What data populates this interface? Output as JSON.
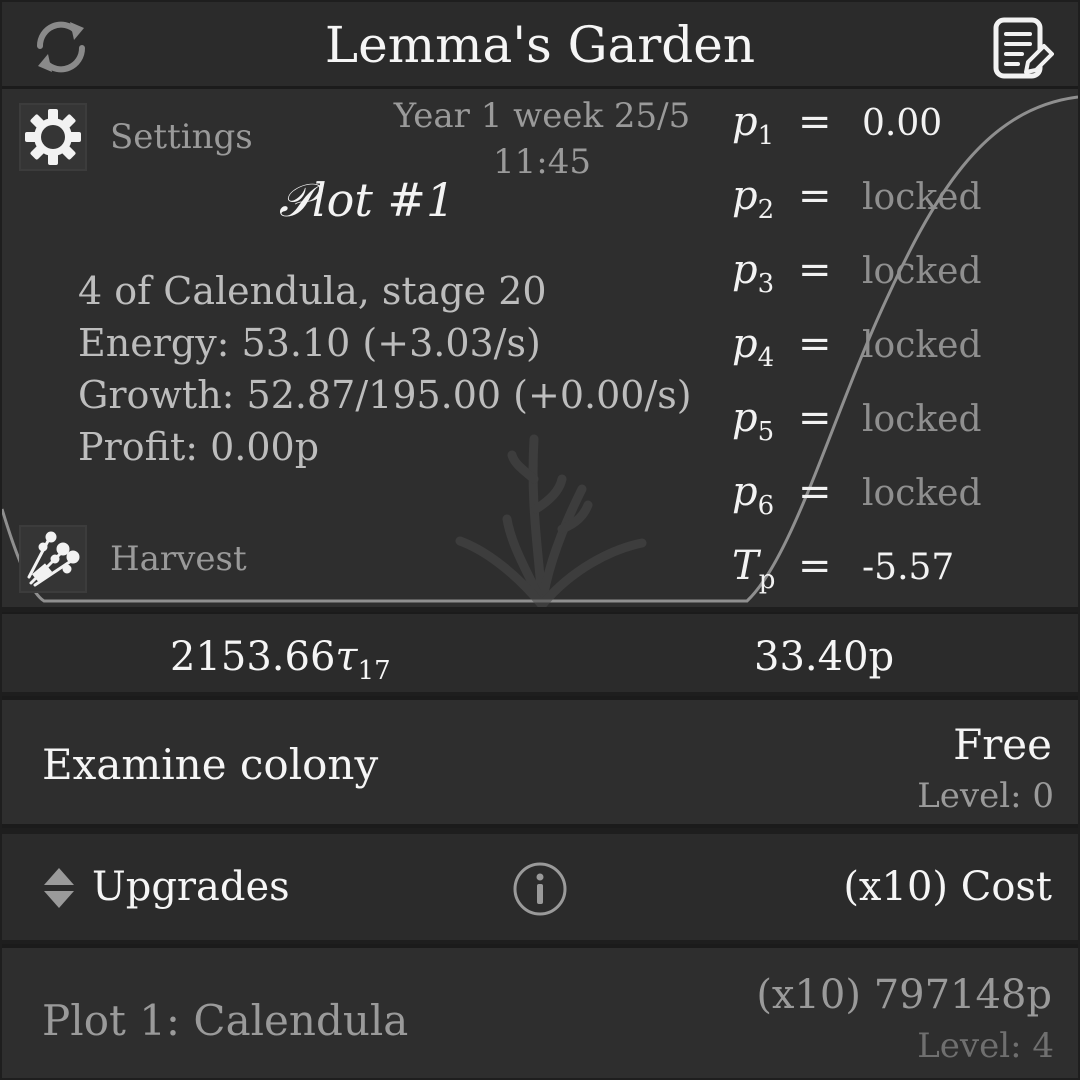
{
  "header": {
    "title": "Lemma's Garden",
    "left_icon": "refresh-icon",
    "right_icon": "notes-edit-icon"
  },
  "plot": {
    "settings_label": "Settings",
    "harvest_label": "Harvest",
    "date": "Year 1 week 25/5",
    "time": "11:45",
    "title": "𝒫lot #1",
    "info": {
      "line1": "4 of Calendula, stage 20",
      "line2": "Energy: 53.10 (+3.03/s)",
      "line3": "Growth: 52.87/195.00 (+0.00/s)",
      "line4": "Profit: 0.00p"
    },
    "variables": [
      {
        "name": "p",
        "sub": "1",
        "eq": "=",
        "value": "0.00",
        "unlocked": true
      },
      {
        "name": "p",
        "sub": "2",
        "eq": "=",
        "value": "locked",
        "unlocked": false
      },
      {
        "name": "p",
        "sub": "3",
        "eq": "=",
        "value": "locked",
        "unlocked": false
      },
      {
        "name": "p",
        "sub": "4",
        "eq": "=",
        "value": "locked",
        "unlocked": false
      },
      {
        "name": "p",
        "sub": "5",
        "eq": "=",
        "value": "locked",
        "unlocked": false
      },
      {
        "name": "p",
        "sub": "6",
        "eq": "=",
        "value": "locked",
        "unlocked": false
      },
      {
        "name": "T",
        "sub": "p",
        "eq": "=",
        "value": "-5.57",
        "unlocked": true
      }
    ]
  },
  "currency": {
    "tau_value": "2153.66",
    "tau_symbol": "τ",
    "tau_sub": "17",
    "money": "33.40p"
  },
  "examine": {
    "label": "Examine colony",
    "cost": "Free",
    "level": "Level: 0"
  },
  "upgrades": {
    "label": "Upgrades",
    "cost_header": "(x10) Cost",
    "items": [
      {
        "name": "Plot 1: Calendula",
        "cost": "(x10) 797148p",
        "level": "Level: 4"
      }
    ]
  },
  "colors": {
    "background": "#2e2e2e",
    "header": "#2b2b2b",
    "text": "#f2f2f2",
    "muted": "#9a9a9a"
  }
}
